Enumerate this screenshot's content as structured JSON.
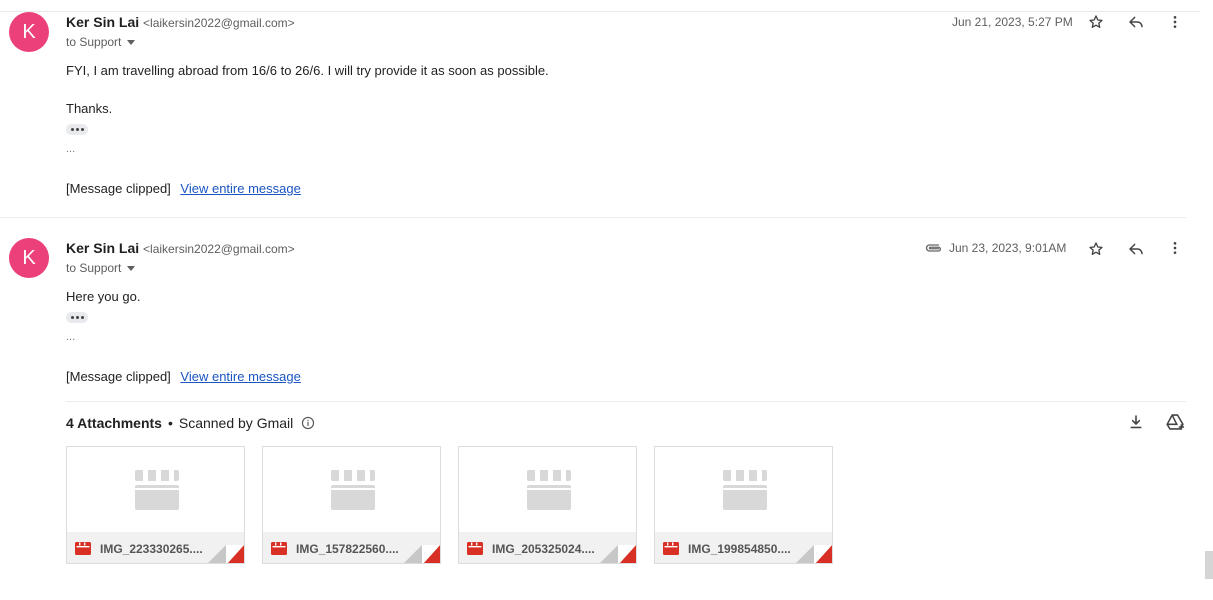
{
  "messages": [
    {
      "avatar_letter": "K",
      "sender_name": "Ker Sin Lai",
      "sender_email": "<laikersin2022@gmail.com>",
      "to": "to Support",
      "date": "Jun 21, 2023, 5:27 PM",
      "body_lines": [
        " FYI, I am travelling abroad from 16/6 to 26/6. I will try provide it as soon as possible.",
        "Thanks."
      ],
      "ellipsis": "...",
      "clipped_text": "[Message clipped]",
      "view_link": "View entire message"
    },
    {
      "avatar_letter": "K",
      "sender_name": "Ker Sin Lai",
      "sender_email": "<laikersin2022@gmail.com>",
      "to": "to Support",
      "date": "Jun 23, 2023, 9:01AM",
      "body_lines": [
        "Here you go."
      ],
      "ellipsis": "...",
      "clipped_text": "[Message clipped]",
      "view_link": "View entire message"
    }
  ],
  "attachments": {
    "count_label": "4 Attachments",
    "separator": "•",
    "scanned_label": "Scanned by Gmail",
    "files": [
      {
        "name": "IMG_223330265...."
      },
      {
        "name": "IMG_157822560...."
      },
      {
        "name": "IMG_205325024...."
      },
      {
        "name": "IMG_199854850...."
      }
    ]
  },
  "icons": {
    "star": "star-icon",
    "reply": "reply-icon",
    "more": "more-vert-icon",
    "clip": "paperclip-icon",
    "download": "download-icon",
    "drive": "add-to-drive-icon",
    "info": "info-icon",
    "video": "video-file-icon"
  },
  "colors": {
    "avatar": "#ec407a",
    "link": "#1a55c2",
    "video_red": "#d93025"
  }
}
